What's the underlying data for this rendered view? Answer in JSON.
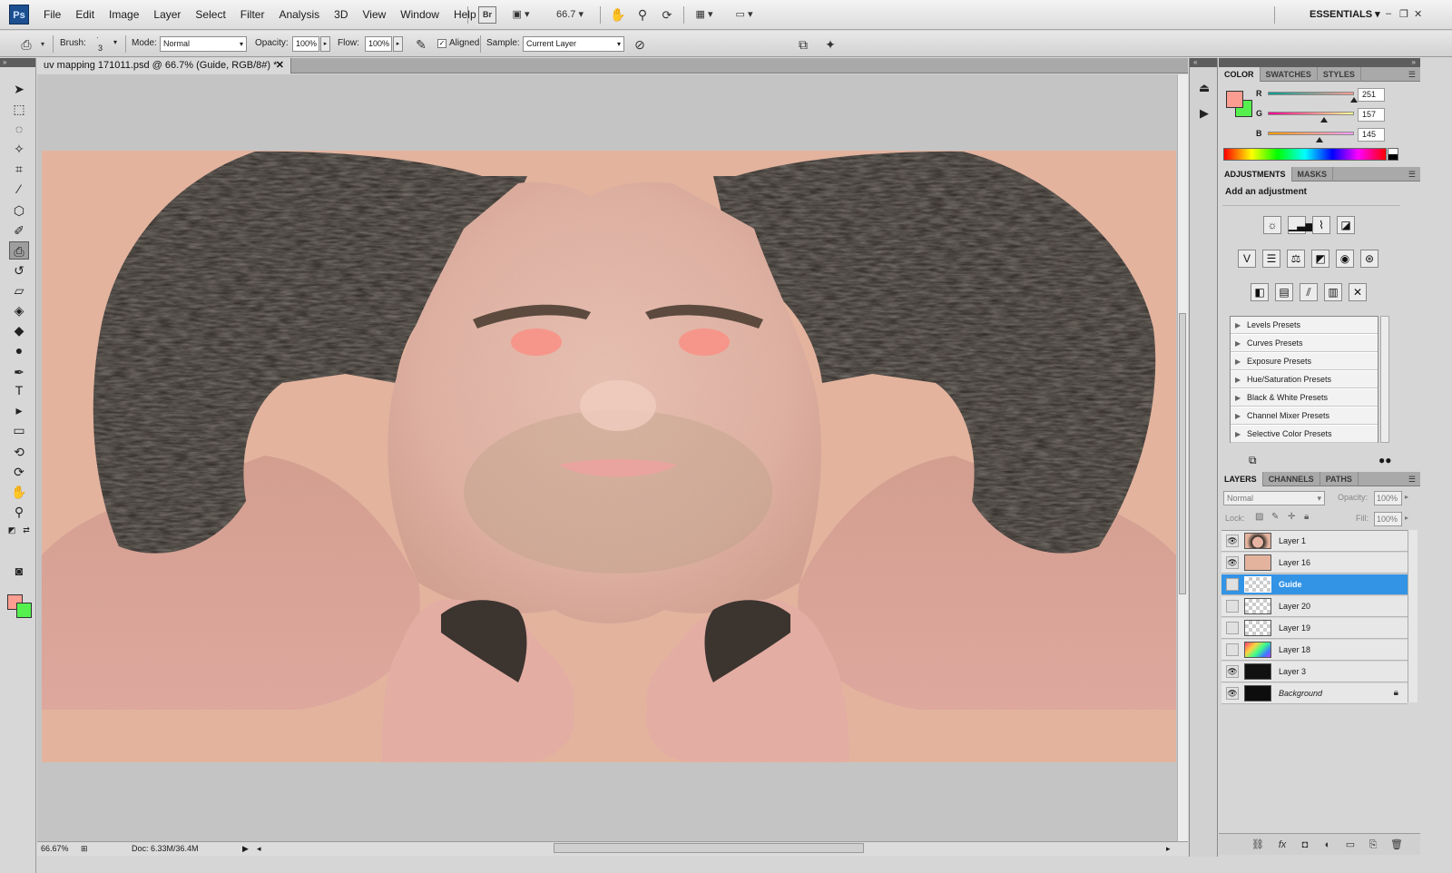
{
  "app": {
    "logo": "Ps",
    "menus": [
      "File",
      "Edit",
      "Image",
      "Layer",
      "Select",
      "Filter",
      "Analysis",
      "3D",
      "View",
      "Window",
      "Help"
    ],
    "bridge_label": "Br",
    "zoom_value": "66.7",
    "workspace": "ESSENTIALS"
  },
  "options_bar": {
    "brush_label": "Brush:",
    "brush_size": "3",
    "mode_label": "Mode:",
    "mode_value": "Normal",
    "opacity_label": "Opacity:",
    "opacity_value": "100%",
    "flow_label": "Flow:",
    "flow_value": "100%",
    "aligned_label": "Aligned",
    "sample_label": "Sample:",
    "sample_value": "Current Layer"
  },
  "document": {
    "tab_title": "uv mapping 171011.psd @ 66.7% (Guide, RGB/8#) *",
    "canvas_bg": "#e3b39e"
  },
  "status": {
    "zoom": "66.67%",
    "doc_info": "Doc: 6.33M/36.4M"
  },
  "color_panel": {
    "tabs": [
      "COLOR",
      "SWATCHES",
      "STYLES"
    ],
    "r_label": "R",
    "g_label": "G",
    "b_label": "B",
    "r_value": "251",
    "g_value": "157",
    "b_value": "145",
    "foreground": "#fb9d91",
    "background": "#55f04e"
  },
  "adjustments_panel": {
    "tabs": [
      "ADJUSTMENTS",
      "MASKS"
    ],
    "heading": "Add an adjustment",
    "presets": [
      "Levels Presets",
      "Curves Presets",
      "Exposure Presets",
      "Hue/Saturation Presets",
      "Black & White Presets",
      "Channel Mixer Presets",
      "Selective Color Presets"
    ]
  },
  "layers_panel": {
    "tabs": [
      "LAYERS",
      "CHANNELS",
      "PATHS"
    ],
    "blend_mode": "Normal",
    "opacity_label": "Opacity:",
    "opacity_value": "100%",
    "lock_label": "Lock:",
    "fill_label": "Fill:",
    "fill_value": "100%",
    "layers": [
      {
        "name": "Layer 1",
        "visible": true,
        "selected": false
      },
      {
        "name": "Layer 16",
        "visible": true,
        "selected": false
      },
      {
        "name": "Guide",
        "visible": false,
        "selected": true
      },
      {
        "name": "Layer 20",
        "visible": false,
        "selected": false
      },
      {
        "name": "Layer 19",
        "visible": false,
        "selected": false
      },
      {
        "name": "Layer 18",
        "visible": false,
        "selected": false
      },
      {
        "name": "Layer 3",
        "visible": true,
        "selected": false
      },
      {
        "name": "Background",
        "visible": true,
        "selected": false,
        "locked": true
      }
    ]
  },
  "colors": {
    "selection_blue": "#3393e5",
    "skin": "#e3b39e",
    "hair": "#2a2521"
  }
}
